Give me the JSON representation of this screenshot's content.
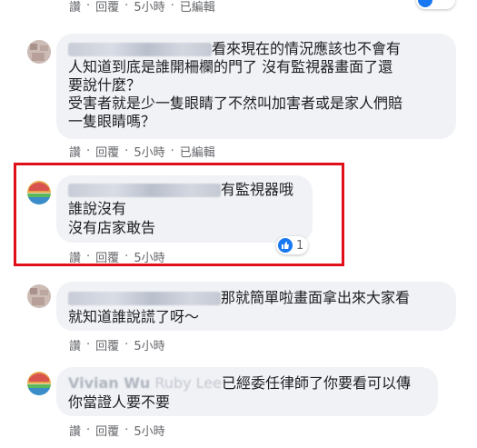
{
  "colors": {
    "accent": "#1877f2",
    "highlight": "#e0101a",
    "bubble": "#f0f2f5",
    "meta": "#65676b"
  },
  "top_actions": {
    "like": "讚",
    "reply": "回覆",
    "time": "5小時",
    "edited": "已編輯"
  },
  "comments": [
    {
      "text_lines": [
        "看來現在的情況應該也不會有",
        "人知道到底是誰開柵欄的門了 沒有監視器畫面了還",
        "要說什麼？",
        "受害者就是少一隻眼睛了不然叫加害者或是家人們賠",
        "一隻眼睛嗎？"
      ],
      "actions": {
        "like": "讚",
        "reply": "回覆",
        "time": "5小時",
        "edited": "已編輯"
      }
    },
    {
      "text_lines": [
        "有監視器哦",
        "誰說沒有",
        "沒有店家敢告"
      ],
      "reaction_count": "1",
      "actions": {
        "like": "讚",
        "reply": "回覆",
        "time": "5小時"
      }
    },
    {
      "text_lines": [
        "那就簡單啦畫面拿出來大家看",
        "就知道誰說謊了呀～"
      ],
      "actions": {
        "like": "讚",
        "reply": "回覆",
        "time": "5小時"
      }
    },
    {
      "name": "Vivian Wu",
      "tag": "Ruby Lee",
      "text_lines": [
        "已經委任律師了你要看可以傳",
        "你當證人要不要"
      ],
      "actions": {
        "like": "讚",
        "reply": "回覆",
        "time": "5小時"
      }
    }
  ]
}
